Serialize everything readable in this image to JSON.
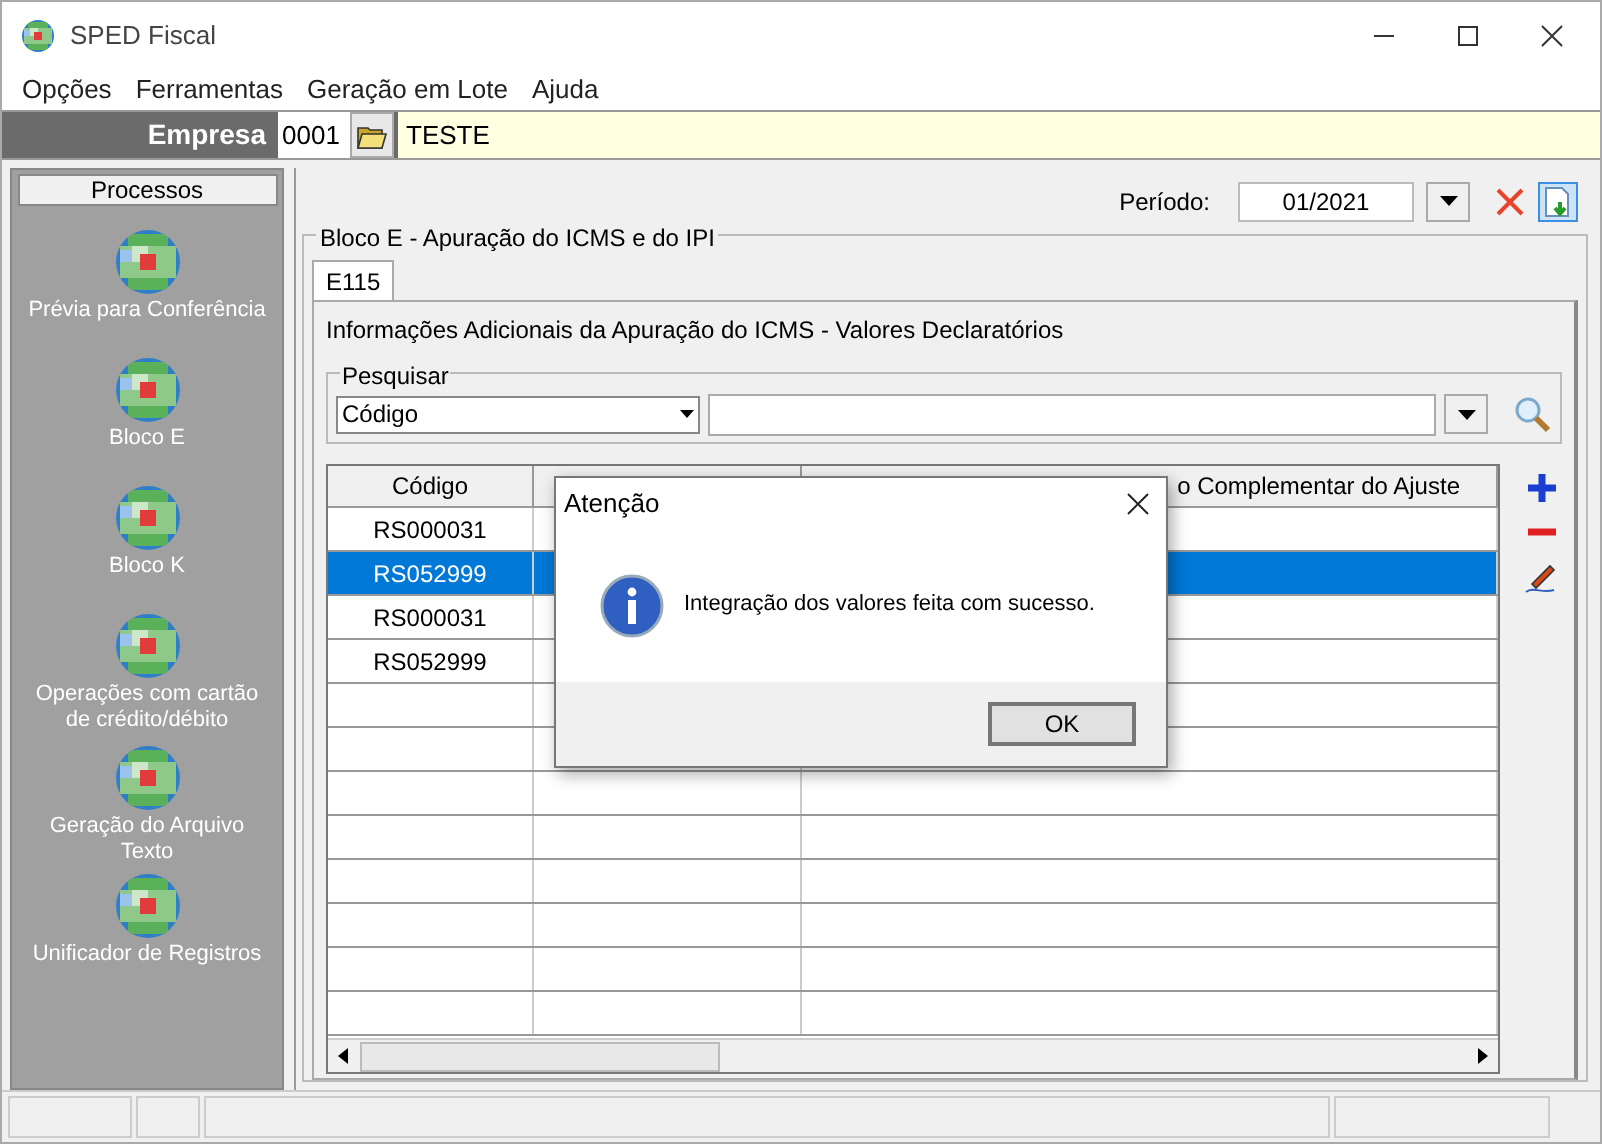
{
  "window": {
    "title": "SPED Fiscal"
  },
  "menu": [
    "Opções",
    "Ferramentas",
    "Geração em Lote",
    "Ajuda"
  ],
  "empresa": {
    "label": "Empresa",
    "code": "0001",
    "name": "TESTE"
  },
  "sidebar": {
    "title": "Processos",
    "items": [
      {
        "label": "Prévia para Conferência"
      },
      {
        "label": "Bloco E"
      },
      {
        "label": "Bloco K"
      },
      {
        "label": "Operações com cartão de crédito/débito"
      },
      {
        "label": "Geração do Arquivo Texto"
      },
      {
        "label": "Unificador de Registros"
      }
    ]
  },
  "periodo": {
    "label": "Período:",
    "value": "01/2021"
  },
  "group": {
    "title": "Bloco E - Apuração do ICMS e do IPI",
    "tabs": [
      {
        "label": "E115",
        "selected": true
      }
    ],
    "subtitle": "Informações Adicionais da Apuração do ICMS - Valores Declaratórios",
    "search": {
      "label": "Pesquisar",
      "field": "Código"
    }
  },
  "table": {
    "columns": [
      {
        "label": "Código"
      },
      {},
      {
        "label": "o Complementar do Ajuste"
      }
    ],
    "rows": [
      {
        "cells": [
          "RS000031"
        ],
        "selected": false
      },
      {
        "cells": [
          "RS052999"
        ],
        "selected": true
      },
      {
        "cells": [
          "RS000031"
        ],
        "selected": false
      },
      {
        "cells": [
          "RS052999"
        ],
        "selected": false
      }
    ]
  },
  "dialog": {
    "title": "Atenção",
    "message": "Integração dos valores feita com sucesso.",
    "button": "OK"
  }
}
